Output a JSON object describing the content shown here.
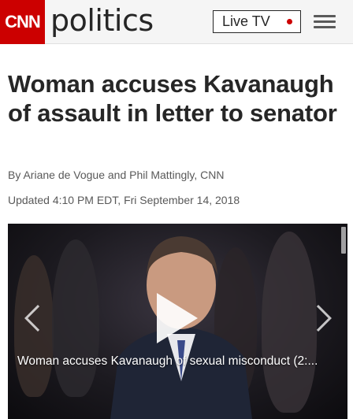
{
  "header": {
    "logo": "CNN",
    "section": "politics",
    "live_tv_label": "Live TV",
    "menu_icon": "hamburger-menu-icon",
    "colors": {
      "brand": "#cc0000",
      "live_dot": "#cc0000"
    }
  },
  "article": {
    "headline": "Woman accuses Kavanaugh of assault in letter to senator",
    "byline": "By Ariane de Vogue and Phil Mattingly, CNN",
    "updated": "Updated 4:10 PM EDT, Fri September 14, 2018"
  },
  "video": {
    "caption": "Woman accuses Kavanaugh of sexual misconduct (2:...",
    "play_icon": "play-icon",
    "prev_icon": "chevron-left-icon",
    "next_icon": "chevron-right-icon"
  }
}
